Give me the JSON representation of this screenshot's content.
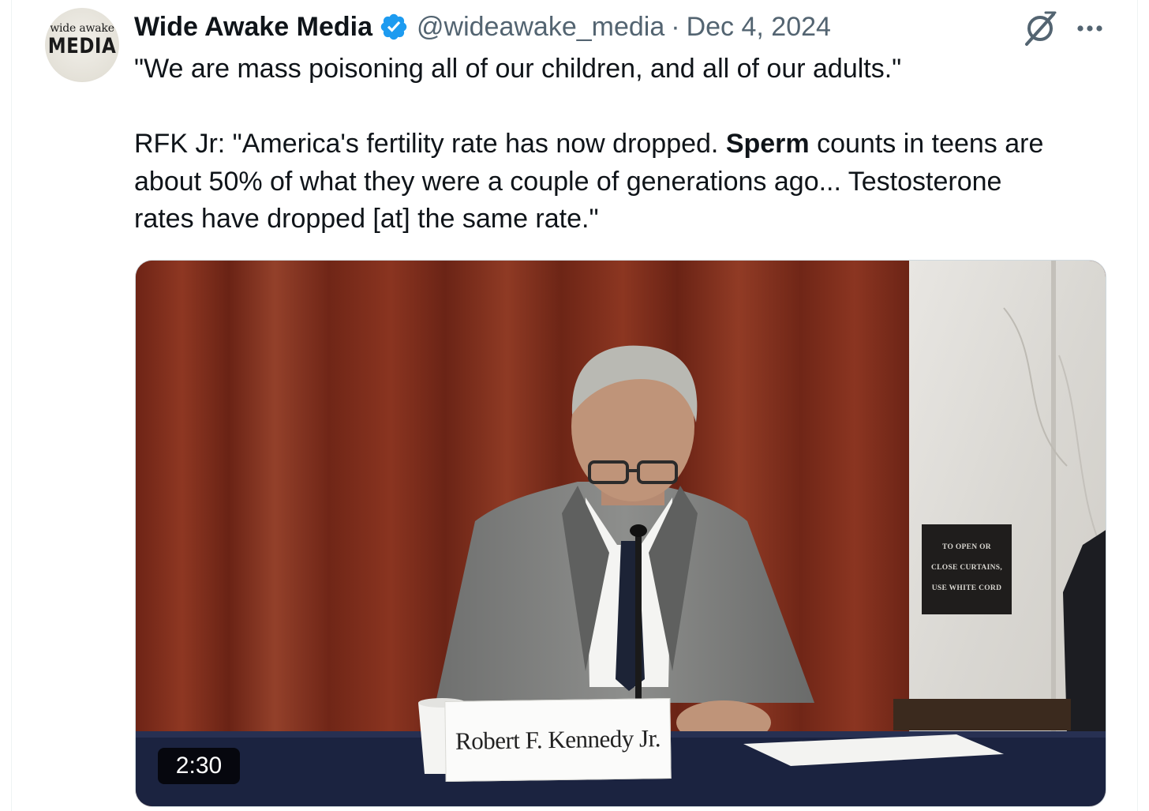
{
  "author": {
    "display_name": "Wide Awake Media",
    "handle": "@wideawake_media",
    "separator": "·",
    "date": "Dec 4, 2024",
    "avatar_logo_text": [
      "wide awake",
      "MEDIA"
    ]
  },
  "tweet": {
    "line1": "\"We are mass poisoning all of our children, and all of our adults.\"",
    "line2_before": "RFK Jr: \"America's fertility rate has now dropped. ",
    "line2_bold": "Sperm",
    "line2_after": " counts in teens are",
    "line3": "about 50% of what they were a couple of generations ago... Testosterone",
    "line4": "rates have dropped [at] the same rate.\""
  },
  "media": {
    "type": "video",
    "duration": "2:30",
    "nameplate": "Robert F. Kennedy Jr.",
    "wall_sign": [
      "TO OPEN OR",
      "CLOSE CURTAINS,",
      "USE WHITE CORD"
    ]
  },
  "icons": {
    "verified": "verified-badge-icon",
    "grok": "grok-icon",
    "more": "more-icon"
  },
  "colors": {
    "accent": "#1d9bf0",
    "secondary_text": "#536471",
    "primary_text": "#0f1419"
  }
}
